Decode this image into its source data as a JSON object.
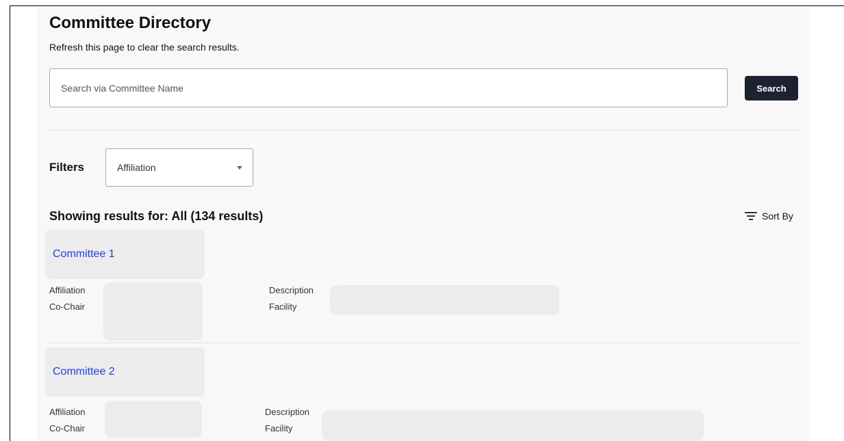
{
  "page": {
    "title": "Committee Directory",
    "subtitle": "Refresh this page to clear the search results."
  },
  "search": {
    "placeholder": "Search via Committee Name",
    "value": "",
    "button_label": "Search"
  },
  "filters": {
    "label": "Filters",
    "affiliation_select": {
      "selected": "Affiliation"
    }
  },
  "results": {
    "heading": "Showing results for: All (134 results)",
    "sort_label": "Sort By",
    "sort_icon": "sort-lines-icon"
  },
  "committees": [
    {
      "name": "Committee 1",
      "labels": {
        "affiliation": "Affiliation",
        "co_chair": "Co-Chair",
        "description": "Description",
        "facility": "Facility"
      }
    },
    {
      "name": "Committee 2",
      "labels": {
        "affiliation": "Affiliation",
        "co_chair": "Co-Chair",
        "description": "Description",
        "facility": "Facility"
      }
    }
  ],
  "colors": {
    "link": "#1f3fe0",
    "button_bg": "#1c2230",
    "panel_bg": "#f8f8f8",
    "placeholder_bg": "#ececec"
  }
}
